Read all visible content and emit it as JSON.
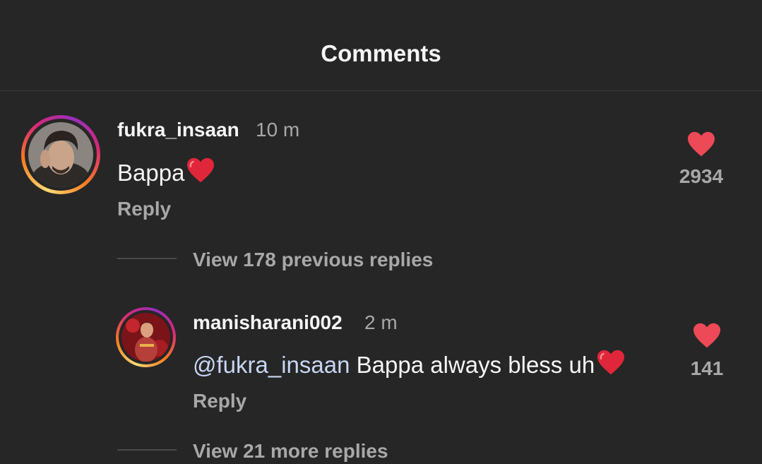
{
  "header": {
    "title": "Comments"
  },
  "comment": {
    "username": "fukra_insaan",
    "time": "10 m",
    "text": "Bappa",
    "text_emoji": "red-heart-emoji",
    "reply_label": "Reply",
    "likes": "2934",
    "view_replies_label": "View 178 previous replies"
  },
  "reply": {
    "username": "manisharani002",
    "time": "2 m",
    "mention": "@fukra_insaan",
    "text": " Bappa always bless uh",
    "text_emoji": "red-heart-emoji",
    "reply_label": "Reply",
    "likes": "141"
  },
  "more_replies": {
    "label": "View 21 more replies"
  },
  "colors": {
    "background": "#262626",
    "like_heart": "#ed4956",
    "mention": "#c7d6f2",
    "secondary_text": "#a8a8a8"
  }
}
